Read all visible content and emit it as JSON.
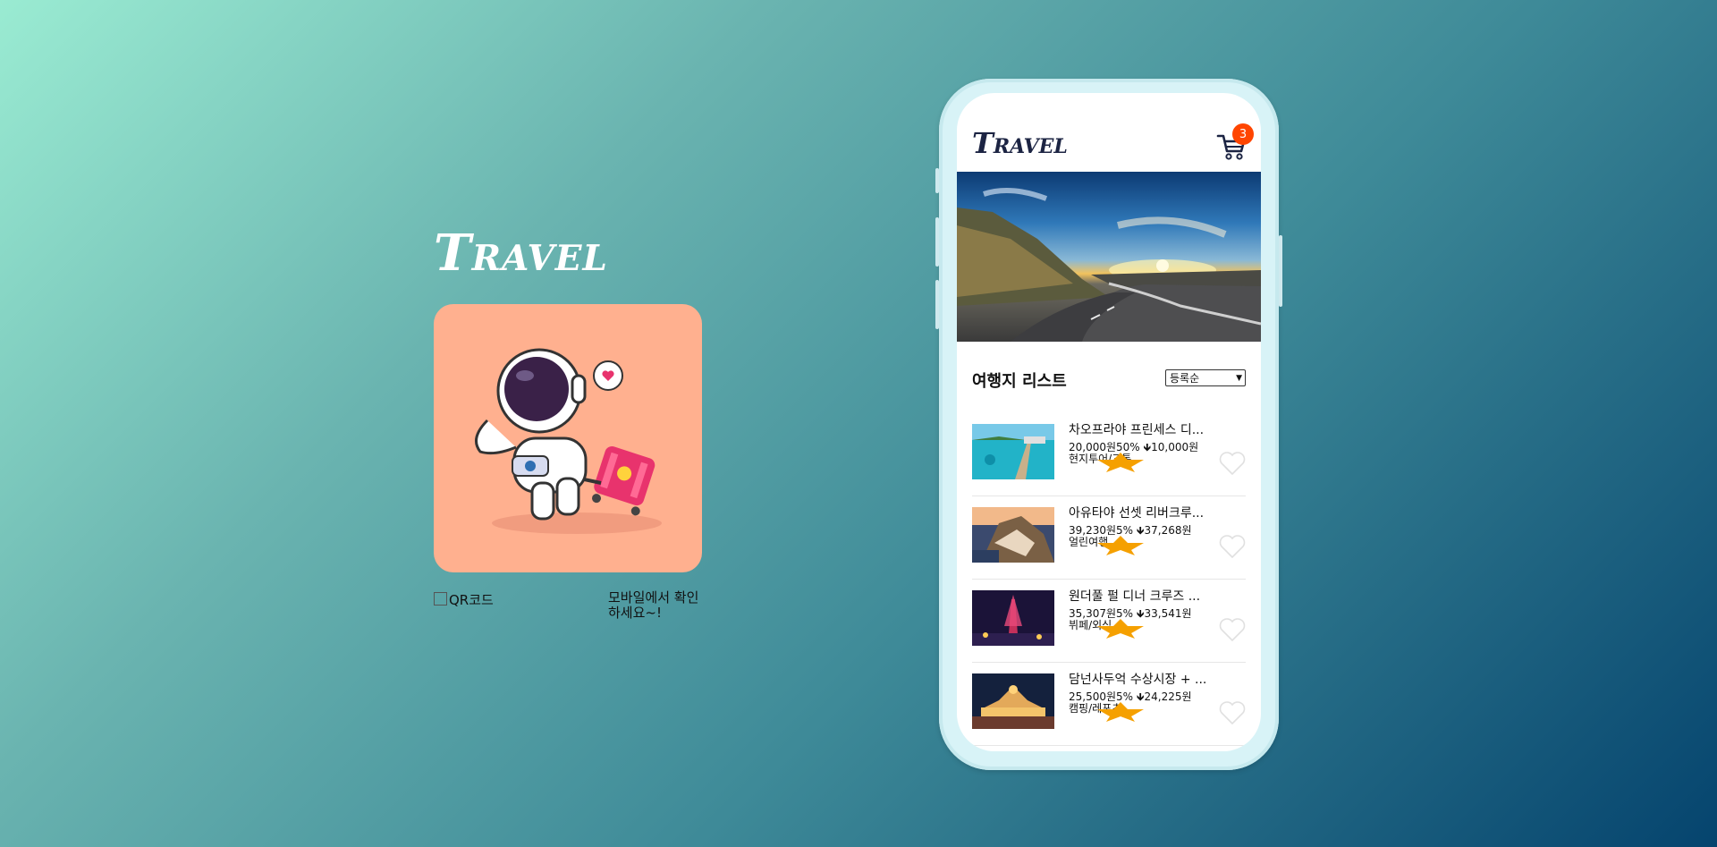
{
  "promo": {
    "brand": "Travel",
    "qr_label": "QR코드",
    "mobile_message": "모바일에서 확인하세요~!"
  },
  "app": {
    "brand": "Travel",
    "cart_count": "3",
    "list_title": "여행지 리스트",
    "sort_selected": "등록순",
    "items": [
      {
        "title": "차오프라야 프린세스 디...",
        "original_price": "20,000원",
        "discount": "50%",
        "sale_price": "10,000원",
        "category": "현지투어/교통"
      },
      {
        "title": "아유타야 선셋 리버크루...",
        "original_price": "39,230원",
        "discount": "5%",
        "sale_price": "37,268원",
        "category": "얼린여행"
      },
      {
        "title": "원더풀 펄 디너 크루즈 ...",
        "original_price": "35,307원",
        "discount": "5%",
        "sale_price": "33,541원",
        "category": "뷔페/외식"
      },
      {
        "title": "담넌사두억 수상시장 + ...",
        "original_price": "25,500원",
        "discount": "5%",
        "sale_price": "24,225원",
        "category": "캠핑/레포츠"
      }
    ]
  },
  "colors": {
    "brand_dark": "#1c2443",
    "badge": "#ff4500",
    "promo_card": "#ffb08f",
    "star": "#f5a000"
  },
  "icons": [
    "cart-icon",
    "heart-icon",
    "star-icon",
    "arrow-down-icon",
    "chevron-down-icon",
    "astronaut-illustration"
  ]
}
